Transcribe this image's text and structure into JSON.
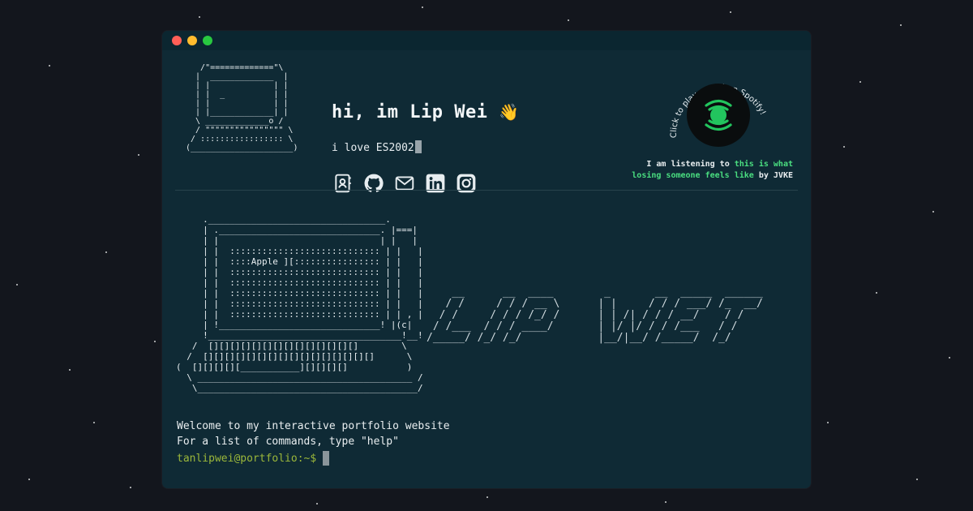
{
  "window": {
    "traffic_lights": [
      "close",
      "minimize",
      "maximize"
    ]
  },
  "header": {
    "computer_ascii": "   /\"=============\"\\\n  |  _____________  |\n  | |             | |\n  | |  _          | |\n  | |             | |\n  | |_____________| |\n  \\ _____________o /\n  / \"\"\"\"\"\"\"\"\"\"\"\"\"\"\"\" \\\n / ::::::::::::::::: \\\n(_____________________)",
    "greeting": "hi, im Lip Wei",
    "greeting_emoji": "👋",
    "tagline": "i love ES2002",
    "socials": [
      {
        "name": "contact-icon"
      },
      {
        "name": "github-icon"
      },
      {
        "name": "email-icon"
      },
      {
        "name": "linkedin-icon"
      },
      {
        "name": "instagram-icon"
      }
    ]
  },
  "spotify": {
    "prompt": "Click to play sound on Spotify!",
    "listening_prefix": "I am listening to",
    "song": "this is what losing someone feels like",
    "by": "by",
    "artist": "JVKE",
    "accent": "#4ade80"
  },
  "main": {
    "apple_ascii": "     ._________________________________.\n     | .______________________________. |===|\n     | |                              | |   |\n     | |  :::::::::::::::::::::::::::: | |   |\n     | |  ::::Apple ][:::::::::::::::: | |   |\n     | |  :::::::::::::::::::::::::::: | |   |\n     | |  :::::::::::::::::::::::::::: | |   |\n     | |  :::::::::::::::::::::::::::: | |   |\n     | |  :::::::::::::::::::::::::::: | |   |\n     | |  :::::::::::::::::::::::::::: | | , |\n     | !______________________________! |(c|\n     !____________________________________!__!\n   /  [][][][][][][][][][][][][][]        \\\n  /  [][][][][][][][][][][][][][][][]      \\\n(  [][][][][___________][][][][]           )\n  \\ ________________________________________ /\n   \\_________________________________________/",
    "name_ascii": "    __      __  ____        _       __  _____  ______\n   / /     / / / __ \\      | |     / / / ___/ /_  __/\n  / /     / / / /_/ /      | | /| / / / __/    / /\n / /___  / / / ____/       | |/ |/ / / /___   / /\n/_____/ /_/ /_/            |__/|__/ /_____/  /_/",
    "welcome_lines": [
      "Welcome to my interactive portfolio website",
      "For a list of commands, type \"help\""
    ],
    "prompt": "tanlipwei@portfolio:~$"
  }
}
